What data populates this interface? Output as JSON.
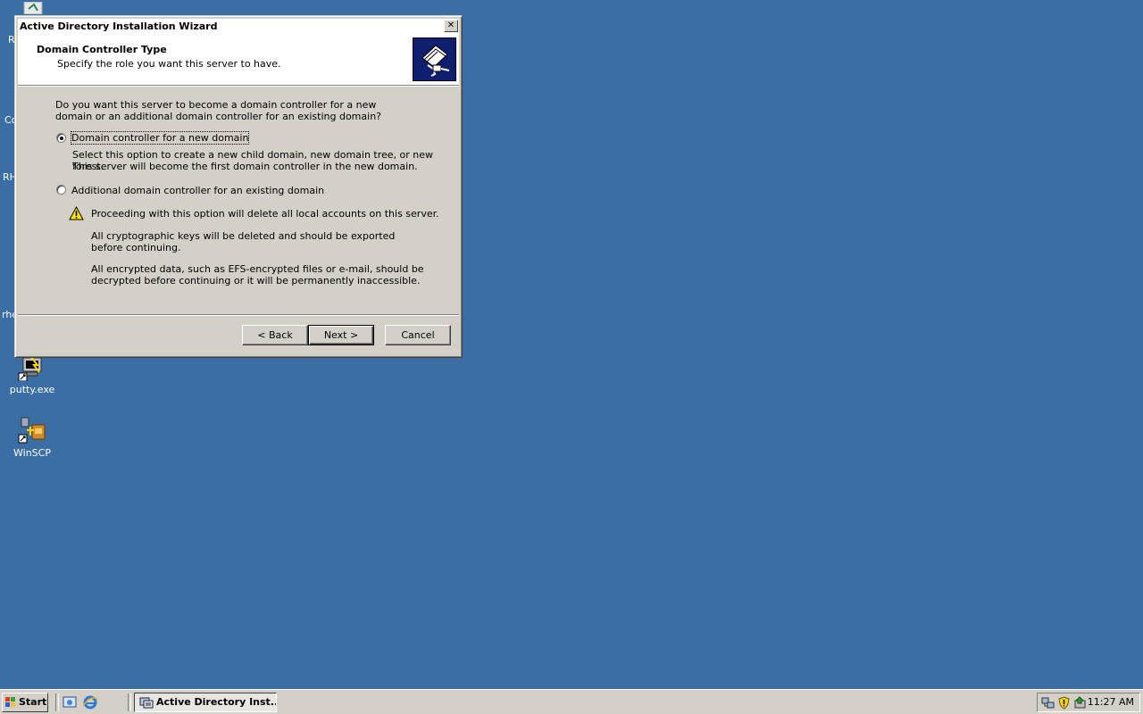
{
  "desktop": {
    "icons": [
      {
        "label": "putty.exe",
        "icon": "putty-icon"
      },
      {
        "label": "WinSCP",
        "icon": "winscp-icon"
      }
    ],
    "partial_labels": [
      "R",
      "Co",
      "RH",
      "rhe"
    ]
  },
  "wizard": {
    "title": "Active Directory Installation Wizard",
    "close_glyph": "✕",
    "header": {
      "title": "Domain Controller Type",
      "subtitle": "Specify the role you want this server to have."
    },
    "question": "Do you want this server to become a domain controller for a new domain or an additional domain controller for an existing domain?",
    "options": [
      {
        "label": "Domain controller for a new domain",
        "selected": true,
        "description_line1": "Select this option to create a new child domain, new domain tree, or new forest.",
        "description_line2": "This server will become the first domain controller in the new domain."
      },
      {
        "label": "Additional domain controller for an existing domain",
        "selected": false
      }
    ],
    "warning": {
      "icon": "warning-icon",
      "line1": "Proceeding with this option will delete all local accounts on this server.",
      "line2": "All cryptographic keys will be deleted and should be exported before continuing.",
      "line3": "All encrypted data, such as EFS-encrypted files or e-mail, should be decrypted before continuing or it will be permanently inaccessible."
    },
    "buttons": {
      "back": "< Back",
      "next": "Next >",
      "cancel": "Cancel"
    }
  },
  "taskbar": {
    "start_label": "Start",
    "active_task": "Active Directory Inst...",
    "clock": "11:27 AM"
  },
  "colors": {
    "desktop": "#3a6ea5",
    "face": "#d4d0c8",
    "header_image": "#0f1f6f"
  }
}
